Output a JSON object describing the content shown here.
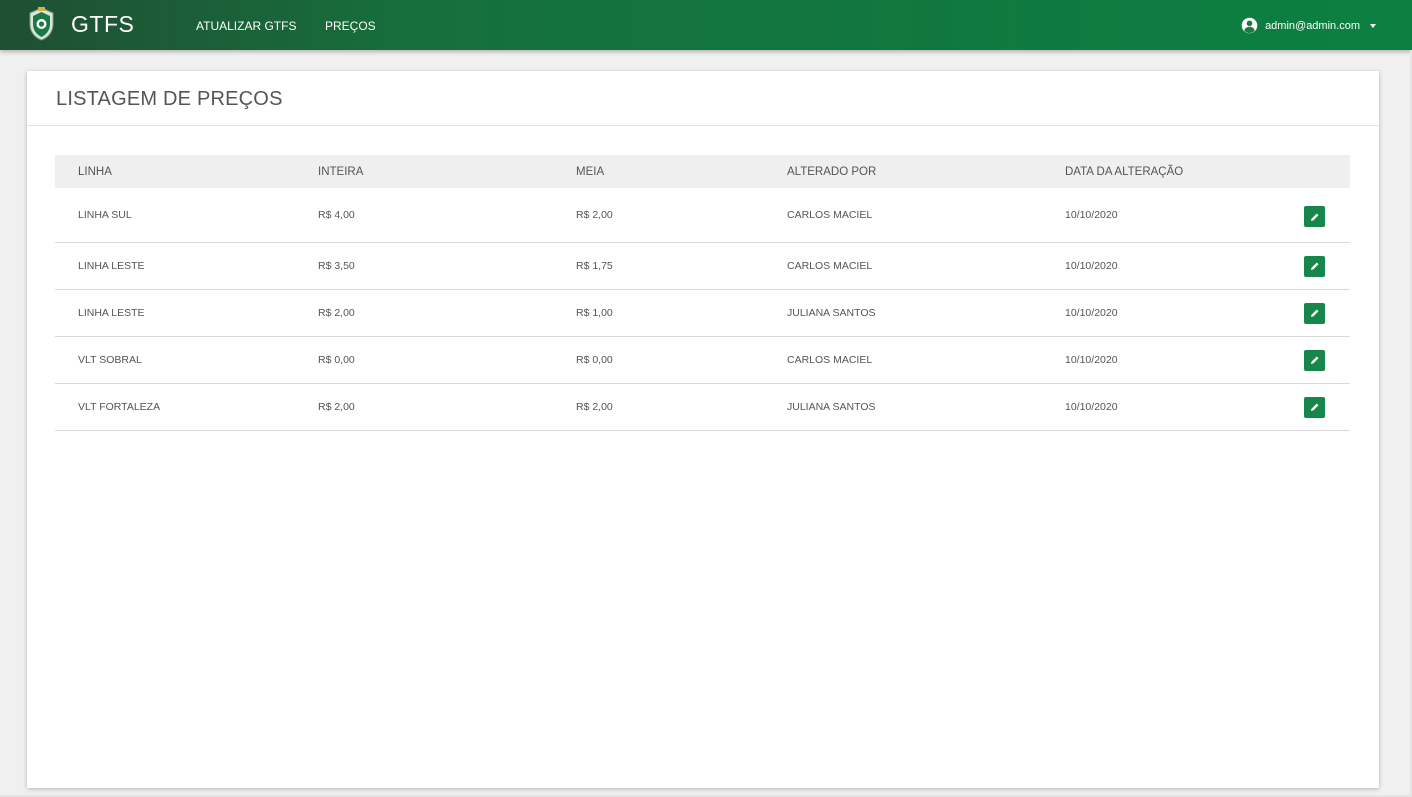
{
  "header": {
    "brand": "GTFS",
    "nav": [
      "ATUALIZAR GTFS",
      "PREÇOS"
    ],
    "user_email": "admin@admin.com"
  },
  "page": {
    "title": "LISTAGEM DE PREÇOS"
  },
  "table": {
    "columns": [
      "LINHA",
      "INTEIRA",
      "MEIA",
      "ALTERADO POR",
      "DATA DA ALTERAÇÃO"
    ],
    "rows": [
      {
        "linha": "LINHA SUL",
        "inteira": "R$ 4,00",
        "meia": "R$ 2,00",
        "alterado_por": "CARLOS MACIEL",
        "data": "10/10/2020"
      },
      {
        "linha": "LINHA LESTE",
        "inteira": "R$ 3,50",
        "meia": "R$ 1,75",
        "alterado_por": "CARLOS MACIEL",
        "data": "10/10/2020"
      },
      {
        "linha": "LINHA LESTE",
        "inteira": "R$ 2,00",
        "meia": "R$ 1,00",
        "alterado_por": "JULIANA SANTOS",
        "data": "10/10/2020"
      },
      {
        "linha": "VLT SOBRAL",
        "inteira": "R$ 0,00",
        "meia": "R$ 0,00",
        "alterado_por": "CARLOS MACIEL",
        "data": "10/10/2020"
      },
      {
        "linha": "VLT FORTALEZA",
        "inteira": "R$ 2,00",
        "meia": "R$ 2,00",
        "alterado_por": "JULIANA SANTOS",
        "data": "10/10/2020"
      }
    ]
  },
  "icons": {
    "logo": "ceara-coat-of-arms-icon",
    "user": "user-circle-icon",
    "caret": "caret-down-icon",
    "edit": "pencil-icon"
  },
  "colors": {
    "accent": "#16864a",
    "header_start": "#1f4f33",
    "header_end": "#0b8041"
  }
}
